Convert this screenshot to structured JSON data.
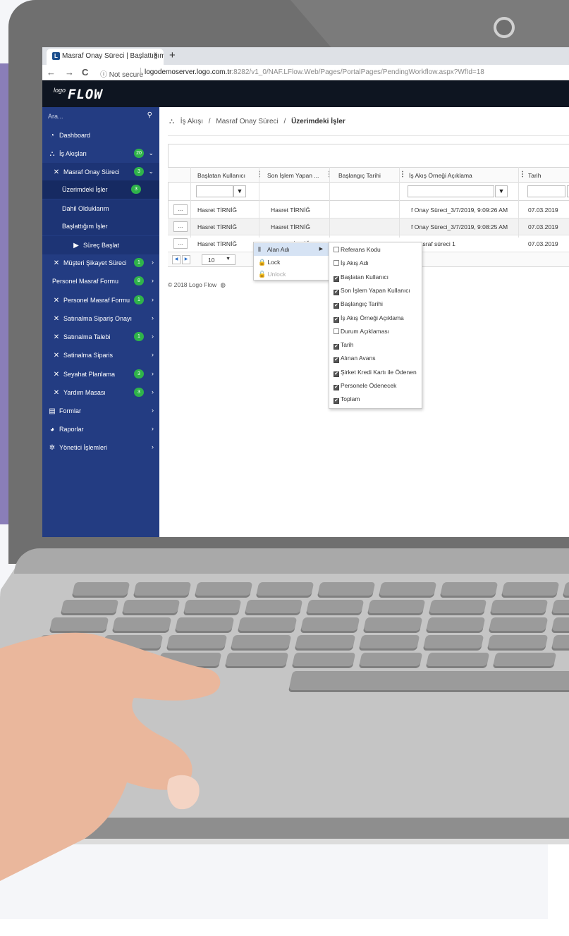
{
  "browser": {
    "tab_title": "Masraf Onay Süreci | Başlattığım",
    "tab_close": "×",
    "new_tab": "+",
    "nav_back": "←",
    "nav_forward": "→",
    "nav_reload": "C",
    "security_label": "ⓘ Not secure",
    "url_host": "logodemoserver.logo.com.tr",
    "url_rest": ":8282/v1_0/NAF.LFlow.Web/Pages/PortalPages/PendingWorkflow.aspx?WfId=18"
  },
  "app": {
    "logo_small": "logo",
    "logo_text": "FLOW"
  },
  "sidebar": {
    "search_placeholder": "Ara...",
    "items": [
      {
        "label": "Dashboard",
        "icon": "dashboard-icon",
        "glyph": "◔",
        "badge": "",
        "chevron": ""
      },
      {
        "label": "İş Akışları",
        "icon": "workflow-icon",
        "glyph": "⛬",
        "badge": "20",
        "chevron": "⌄"
      },
      {
        "label": "Masraf Onay Süreci",
        "icon": "tools-icon",
        "glyph": "✕",
        "badge": "3",
        "chevron": "⌄"
      },
      {
        "label": "Üzerimdeki İşler",
        "icon": "",
        "glyph": "",
        "badge": "3",
        "chevron": ""
      },
      {
        "label": "Dahil Olduklarım",
        "icon": "",
        "glyph": "",
        "badge": "",
        "chevron": ""
      },
      {
        "label": "Başlattığım İşler",
        "icon": "",
        "glyph": "",
        "badge": "",
        "chevron": ""
      },
      {
        "label": "Süreç Başlat",
        "icon": "play-icon",
        "glyph": "▶",
        "badge": "",
        "chevron": ""
      },
      {
        "label": "Müşteri Şikayet Süreci",
        "icon": "tools-icon",
        "glyph": "✕",
        "badge": "1",
        "chevron": "›"
      },
      {
        "label": "Personel Masraf Formu",
        "icon": "",
        "glyph": "",
        "badge": "8",
        "chevron": "›"
      },
      {
        "label": "Personel Masraf Formu",
        "icon": "tools-icon",
        "glyph": "✕",
        "badge": "1",
        "chevron": "›"
      },
      {
        "label": "Satınalma Sipariş Onayı",
        "icon": "tools-icon",
        "glyph": "✕",
        "badge": "",
        "chevron": "›"
      },
      {
        "label": "Satınalma Talebi",
        "icon": "tools-icon",
        "glyph": "✕",
        "badge": "1",
        "chevron": "›"
      },
      {
        "label": "Satinalma Siparis",
        "icon": "tools-icon",
        "glyph": "✕",
        "badge": "",
        "chevron": "›"
      },
      {
        "label": "Seyahat Planlama",
        "icon": "tools-icon",
        "glyph": "✕",
        "badge": "3",
        "chevron": "›"
      },
      {
        "label": "Yardım Masası",
        "icon": "tools-icon",
        "glyph": "✕",
        "badge": "3",
        "chevron": "›"
      },
      {
        "label": "Formlar",
        "icon": "form-icon",
        "glyph": "▤",
        "badge": "",
        "chevron": "›"
      },
      {
        "label": "Raporlar",
        "icon": "chart-pie-icon",
        "glyph": "◕",
        "badge": "",
        "chevron": "›"
      },
      {
        "label": "Yönetici İşlemleri",
        "icon": "gear-icon",
        "glyph": "✲",
        "badge": "",
        "chevron": "›"
      }
    ]
  },
  "breadcrumb": {
    "icon": "sitemap-icon",
    "glyph": "⛬",
    "part1": "İş Akışı",
    "sep": "/",
    "part2": "Masraf Onay Süreci",
    "current": "Üzerimdeki İşler"
  },
  "grid": {
    "columns": [
      "Başlatan Kullanıcı",
      "Son İşlem Yapan ...",
      "Başlangıç Tarihi",
      "İş Akış Örneği Açıklama",
      "Tarih"
    ],
    "column_menu_glyph": "⋮",
    "filter_glyph": "▼",
    "row_button": "...",
    "rows": [
      {
        "baslatan": "Hasret TİRNİĞ",
        "son_islem": "Hasret TİRNİĞ",
        "aciklama": "f Onay Süreci_3/7/2019, 9:09:26 AM",
        "tarih": "07.03.2019"
      },
      {
        "baslatan": "Hasret TİRNİĞ",
        "son_islem": "Hasret TİRNİĞ",
        "aciklama": "f Onay Süreci_3/7/2019, 9:08:25 AM",
        "tarih": "07.03.2019"
      },
      {
        "baslatan": "Hasret TİRNİĞ",
        "son_islem": "Hasret TİRNİĞ",
        "aciklama": ": masraf süreci 1",
        "tarih": "07.03.2019"
      }
    ],
    "pager": {
      "prev": "◀",
      "next": "▶",
      "page_size": "10",
      "dropdown_glyph": "▼"
    }
  },
  "footer": {
    "text": "© 2018 Logo Flow"
  },
  "context_menu": {
    "items": [
      {
        "label": "Alan Adı",
        "glyph": "⦀",
        "icon": "columns-icon",
        "submenu_arrow": "▶"
      },
      {
        "label": "Lock",
        "glyph": "🔒",
        "icon": "lock-icon"
      },
      {
        "label": "Unlock",
        "glyph": "🔓",
        "icon": "unlock-icon"
      }
    ],
    "pointer_glyph": "☝"
  },
  "column_chooser": {
    "items": [
      {
        "label": "Referans Kodu",
        "checked": false
      },
      {
        "label": "İş Akış Adı",
        "checked": false
      },
      {
        "label": "Başlatan Kullanıcı",
        "checked": true
      },
      {
        "label": "Son İşlem Yapan Kullanıcı",
        "checked": true
      },
      {
        "label": "Başlangıç Tarihi",
        "checked": true
      },
      {
        "label": "İş Akış Örneği Açıklama",
        "checked": true
      },
      {
        "label": "Durum Açıklaması",
        "checked": false
      },
      {
        "label": "Tarih",
        "checked": true
      },
      {
        "label": "Alınan Avans",
        "checked": true
      },
      {
        "label": "Şirket Kredi Kartı ile Ödenen",
        "checked": true
      },
      {
        "label": "Personele Ödenecek",
        "checked": true
      },
      {
        "label": "Toplam",
        "checked": true
      }
    ],
    "check_glyph": "✔"
  },
  "colors": {
    "sidebar": "#233c82",
    "appbar": "#0e1521",
    "badge": "#2fb34a",
    "background_accent": "#8a7eb8",
    "skin": "#eab79c"
  }
}
